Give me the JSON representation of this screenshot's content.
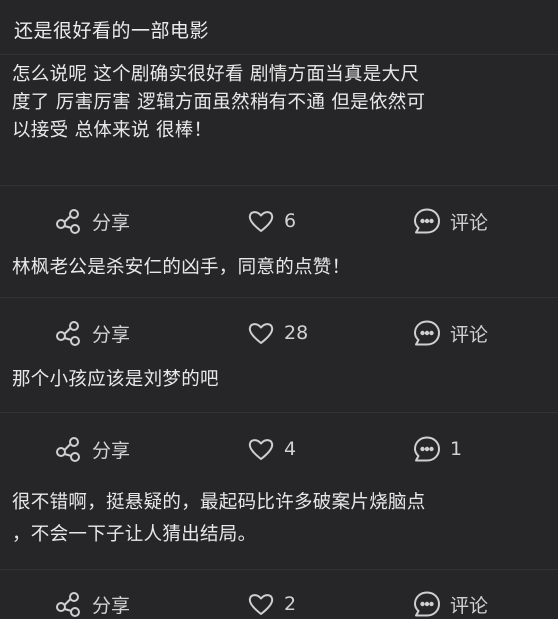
{
  "post": {
    "title": "还是很好看的一部电影",
    "body_lines": [
      "怎么说呢 这个剧确实很好看 剧情方面当真是大尺",
      "度了 厉害厉害 逻辑方面虽然稍有不通 但是依然可",
      "以接受 总体来说 很棒！"
    ],
    "actions": {
      "share": "分享",
      "likes": "6",
      "comment": "评论"
    }
  },
  "comments": [
    {
      "lines": [
        "林枫老公是杀安仁的凶手，同意的点赞！"
      ],
      "actions": {
        "share": "分享",
        "likes": "28",
        "comment": "评论"
      }
    },
    {
      "lines": [
        "那个小孩应该是刘梦的吧"
      ],
      "actions": {
        "share": "分享",
        "likes": "4",
        "comment": "1"
      }
    },
    {
      "lines": [
        "很不错啊，挺悬疑的，最起码比许多破案片烧脑点",
        "，不会一下子让人猜出结局。"
      ],
      "actions": {
        "share": "分享",
        "likes": "2",
        "comment": "评论"
      }
    }
  ],
  "icons": {
    "share": "share-icon",
    "like": "heart-icon",
    "comment": "comment-bubble-icon"
  }
}
